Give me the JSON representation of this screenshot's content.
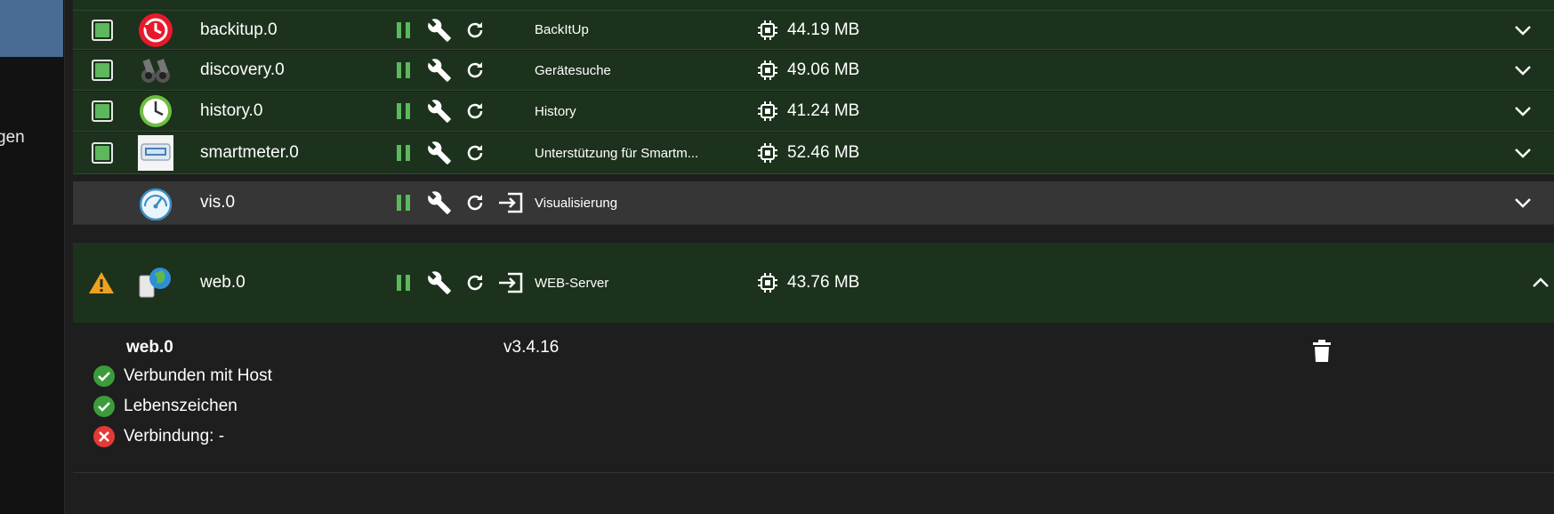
{
  "sidebar": {
    "cut_label": "gen"
  },
  "adapters": [
    {
      "name": "backitup.0",
      "description": "BackItUp",
      "memory": "44.19 MB",
      "logo": "backitup-clock-icon",
      "checked": true
    },
    {
      "name": "discovery.0",
      "description": "Gerätesuche",
      "memory": "49.06 MB",
      "logo": "binoculars-icon",
      "checked": true
    },
    {
      "name": "history.0",
      "description": "History",
      "memory": "41.24 MB",
      "logo": "history-clock-icon",
      "checked": true
    },
    {
      "name": "smartmeter.0",
      "description": "Unterstützung für Smartm...",
      "memory": "52.46 MB",
      "logo": "smartmeter-icon",
      "checked": true
    },
    {
      "name": "vis.0",
      "description": "Visualisierung",
      "memory": "",
      "logo": "gauge-icon",
      "checked": false
    },
    {
      "name": "web.0",
      "description": "WEB-Server",
      "memory": "43.76 MB",
      "logo": "web-globe-icon",
      "checked": false
    }
  ],
  "detail": {
    "name": "web.0",
    "version": "v3.4.16",
    "statuses": [
      {
        "label": "Verbunden mit Host",
        "ok": true
      },
      {
        "label": "Lebenszeichen",
        "ok": true
      },
      {
        "label": "Verbindung: -",
        "ok": false
      }
    ]
  },
  "colors": {
    "row_green": "#1c321c",
    "row_gray": "#363636",
    "accent_green": "#5cb85c",
    "warning": "#f0a020",
    "error": "#e53935",
    "sidebar_active": "#4a6b94"
  }
}
